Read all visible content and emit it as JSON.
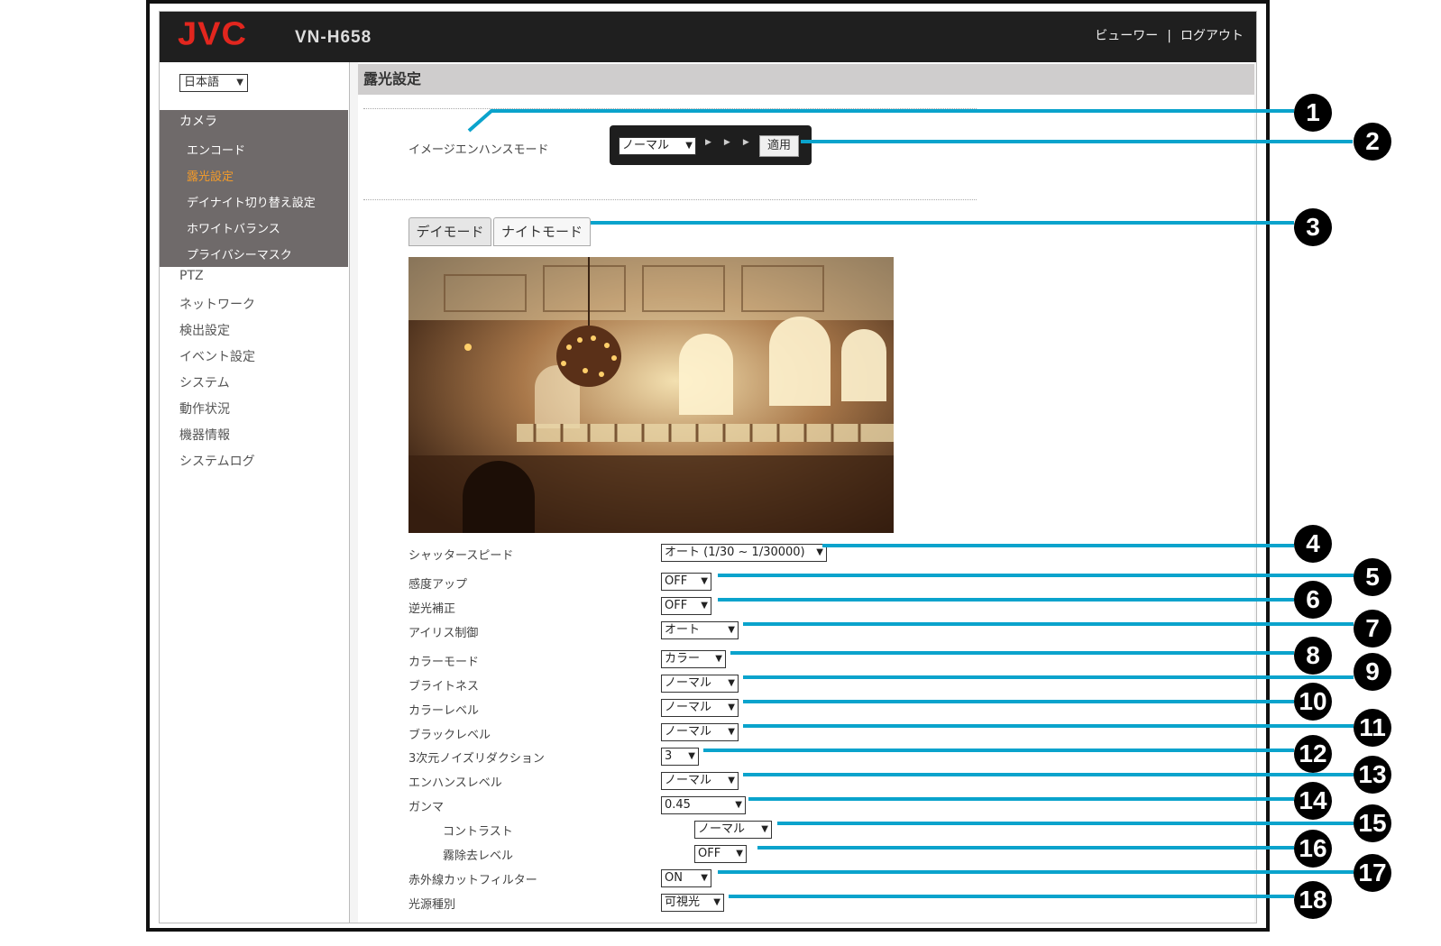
{
  "header": {
    "logo": "JVC",
    "model": "VN-H658",
    "viewer": "ビューワー",
    "separator": "|",
    "logout": "ログアウト"
  },
  "sidebar": {
    "language": "日本語",
    "camera": "カメラ",
    "camera_items": [
      "エンコード",
      "露光設定",
      "デイナイト切り替え設定",
      "ホワイトバランス",
      "プライバシーマスク"
    ],
    "nav": [
      "PTZ",
      "ネットワーク",
      "検出設定",
      "イベント設定",
      "システム",
      "動作状況",
      "機器情報",
      "システムログ"
    ]
  },
  "main": {
    "title": "露光設定",
    "image_enhance_label": "イメージエンハンスモード",
    "image_enhance_value": "ノーマル",
    "apply": "適用",
    "tabs": [
      "デイモード",
      "ナイトモード"
    ],
    "settings": [
      {
        "label": "シャッタースピード",
        "value": "オート (1/30 ~ 1/30000)"
      },
      {
        "label": "感度アップ",
        "value": "OFF"
      },
      {
        "label": "逆光補正",
        "value": "OFF"
      },
      {
        "label": "アイリス制御",
        "value": "オート"
      },
      {
        "label": "カラーモード",
        "value": "カラー"
      },
      {
        "label": "ブライトネス",
        "value": "ノーマル"
      },
      {
        "label": "カラーレベル",
        "value": "ノーマル"
      },
      {
        "label": "ブラックレベル",
        "value": "ノーマル"
      },
      {
        "label": "3次元ノイズリダクション",
        "value": "3"
      },
      {
        "label": "エンハンスレベル",
        "value": "ノーマル"
      },
      {
        "label": "ガンマ",
        "value": "0.45"
      },
      {
        "label": "コントラスト",
        "value": "ノーマル"
      },
      {
        "label": "霧除去レベル",
        "value": "OFF"
      },
      {
        "label": "赤外線カットフィルター",
        "value": "ON"
      },
      {
        "label": "光源種別",
        "value": "可視光"
      }
    ]
  },
  "callouts": [
    "1",
    "2",
    "3",
    "4",
    "5",
    "6",
    "7",
    "8",
    "9",
    "10",
    "11",
    "12",
    "13",
    "14",
    "15",
    "16",
    "17",
    "18"
  ],
  "colors": {
    "accent_line": "#0aa3cc",
    "logo_red": "#e2261e",
    "active_menu": "#f39b2a"
  }
}
